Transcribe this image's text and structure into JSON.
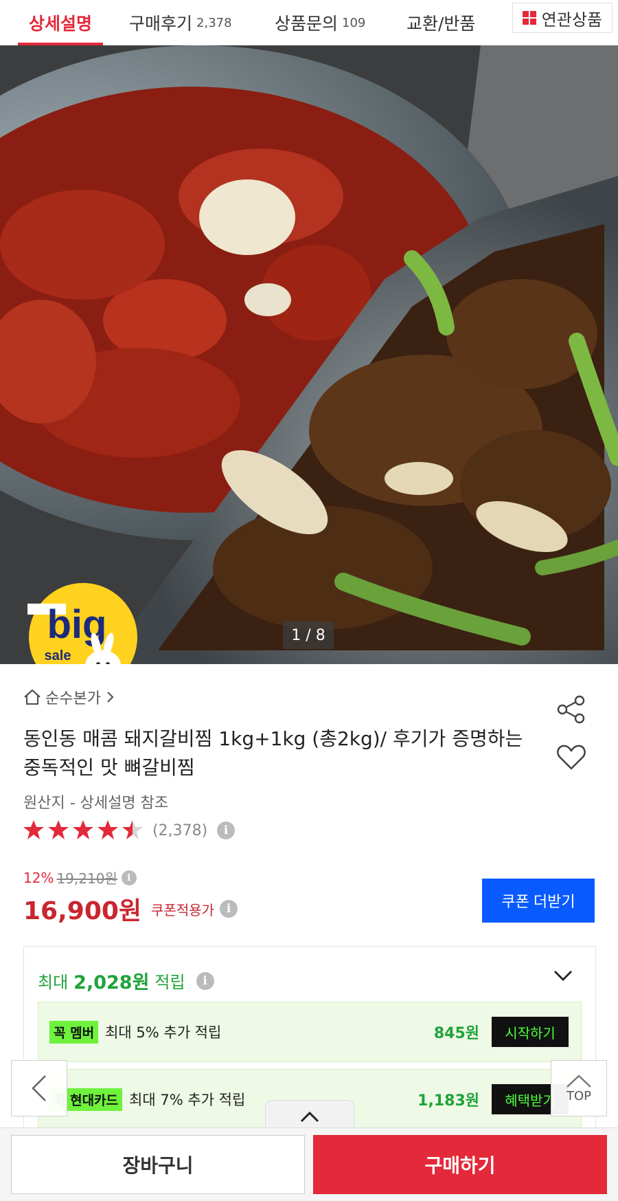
{
  "tabs": [
    {
      "label": "상세설명",
      "count": ""
    },
    {
      "label": "구매후기",
      "count": "2,378"
    },
    {
      "label": "상품문의",
      "count": "109"
    },
    {
      "label": "교환/반품",
      "count": ""
    }
  ],
  "related_tab": {
    "label": "연관상품",
    "icon": "grid-icon"
  },
  "hero": {
    "pager": "1 / 8",
    "badge_word": "big",
    "badge_sub": "sale"
  },
  "product": {
    "seller": "순수본가",
    "title": "동인동 매콤 돼지갈비찜 1kg+1kg (총2kg)/ 후기가 증명하는 중독적인 맛 뼈갈비찜",
    "origin": "원산지 - 상세설명 참조",
    "rating_value": 4.5,
    "review_count": "(2,378)"
  },
  "price": {
    "discount": "12%",
    "original": "19,210원",
    "final": "16,900원",
    "note": "쿠폰적용가",
    "coupon_button": "쿠폰 더받기"
  },
  "points": {
    "label": "최대",
    "amount": "2,028원",
    "suffix": "적립",
    "benefits": [
      {
        "tag": "꼭 멤버",
        "desc": "최대 5% 추가 적립",
        "amount": "845원",
        "action": "시작하기"
      },
      {
        "tag": "꼭 현대카드",
        "desc": "최대 7% 추가 적립",
        "amount": "1,183원",
        "action": "혜택받기"
      }
    ]
  },
  "floating": {
    "top_label": "TOP"
  },
  "bottom": {
    "cart": "장바구니",
    "buy": "구매하기"
  },
  "colors": {
    "accent": "#e3293a",
    "price": "#c82630",
    "coupon": "#0a5bff",
    "points": "#1fa33a"
  }
}
